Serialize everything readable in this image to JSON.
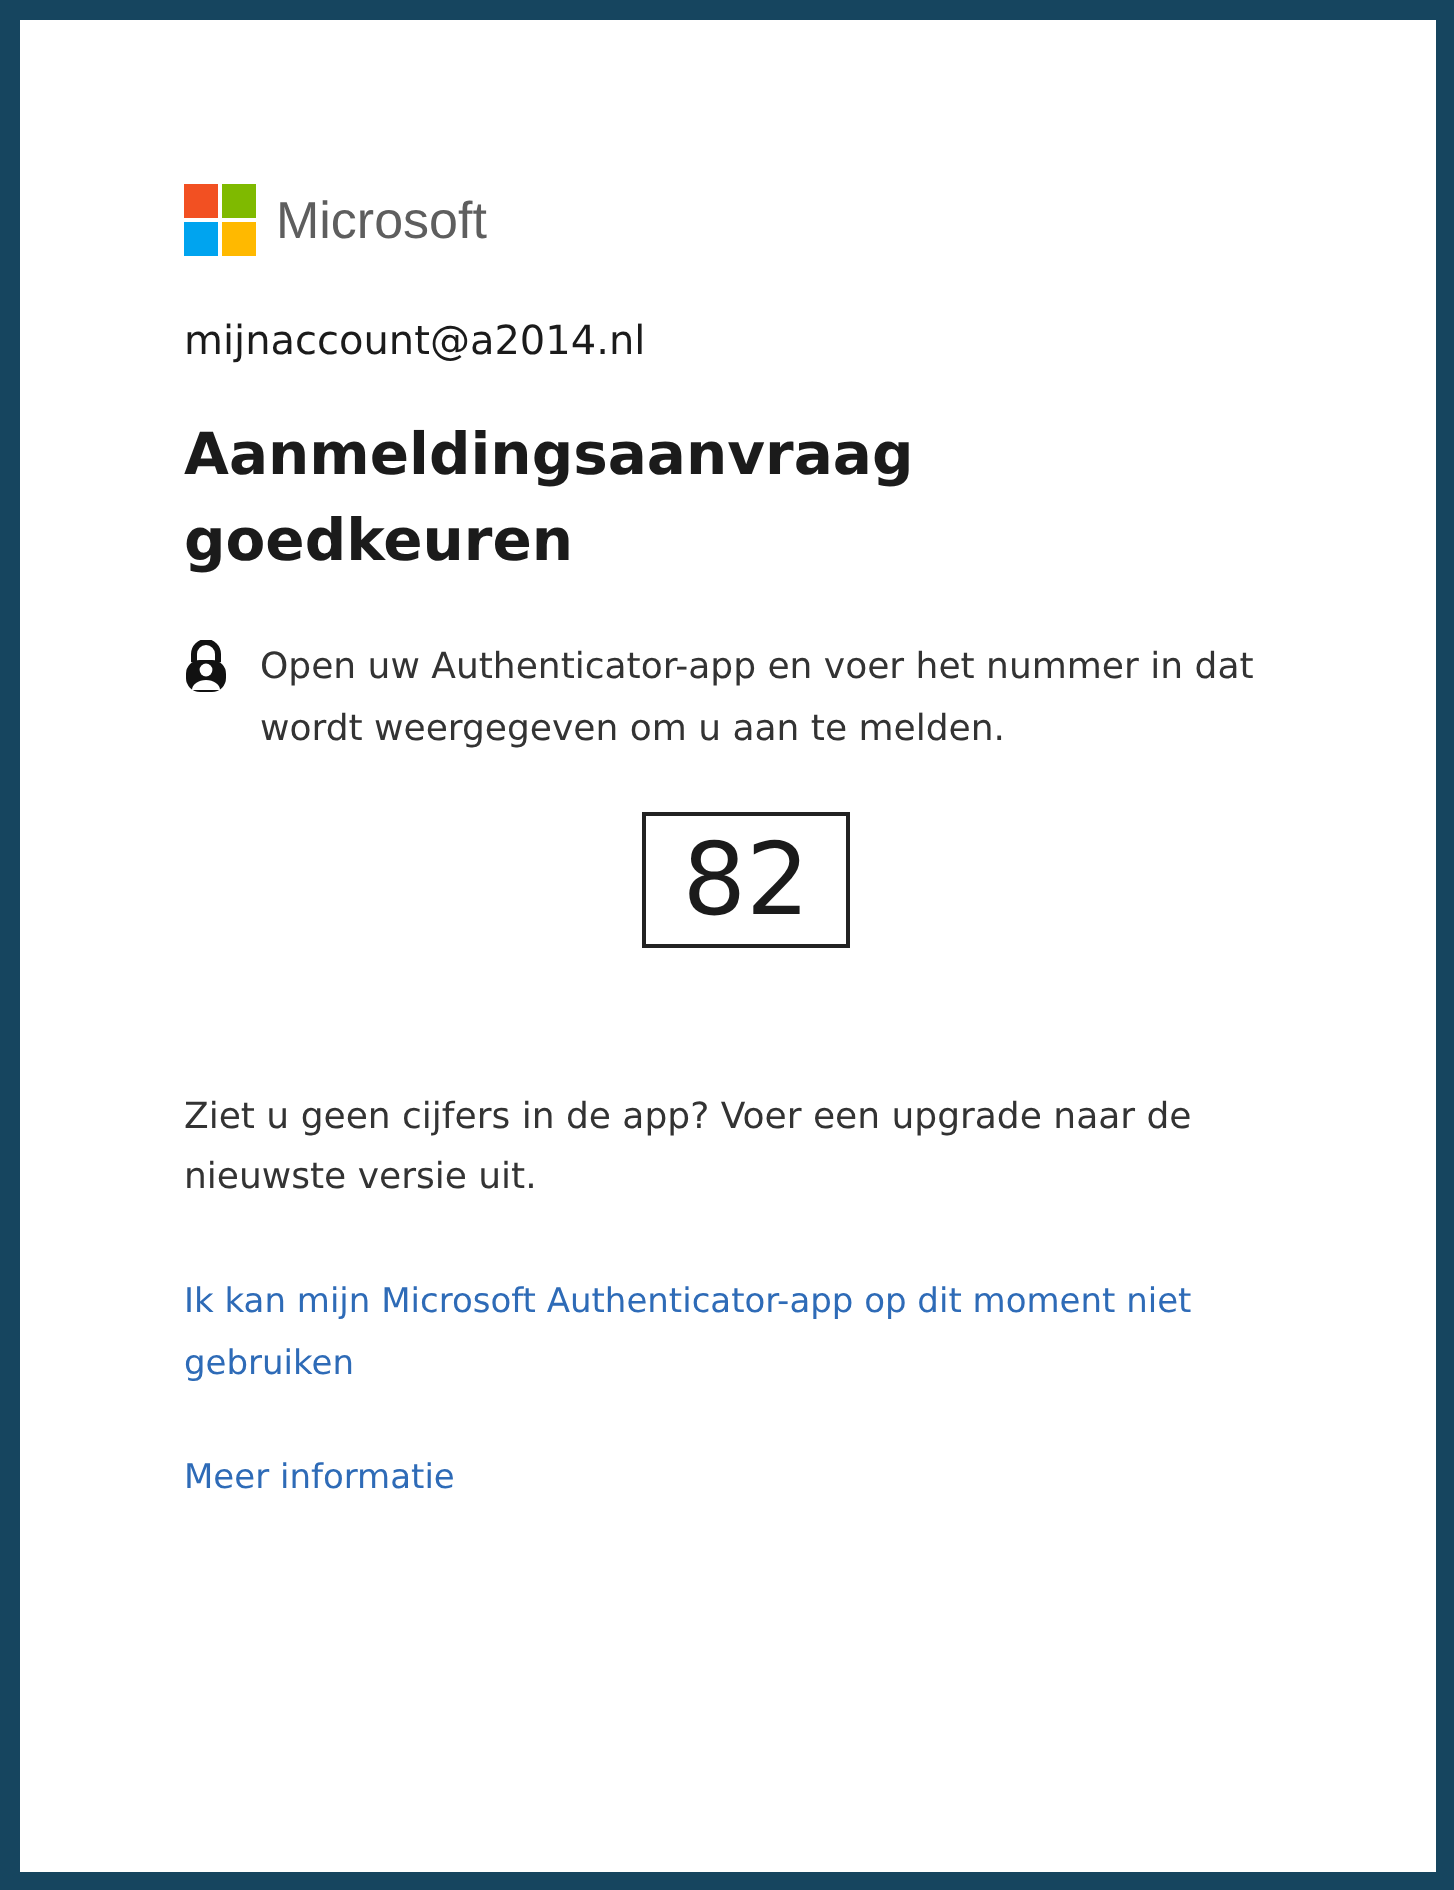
{
  "brand": {
    "name": "Microsoft"
  },
  "account": "mijnaccount@a2014.nl",
  "title": "Aanmeldingsaanvraag goedkeuren",
  "instruction": "Open uw Authenticator-app en voer het nummer in dat wordt weergegeven om u aan te melden.",
  "number": "82",
  "hint": "Ziet u geen cijfers in de app? Voer een upgrade naar de nieuwste versie uit.",
  "links": [
    "Ik kan mijn Microsoft Authenticator-app op dit moment niet gebruiken",
    "Meer informatie"
  ]
}
